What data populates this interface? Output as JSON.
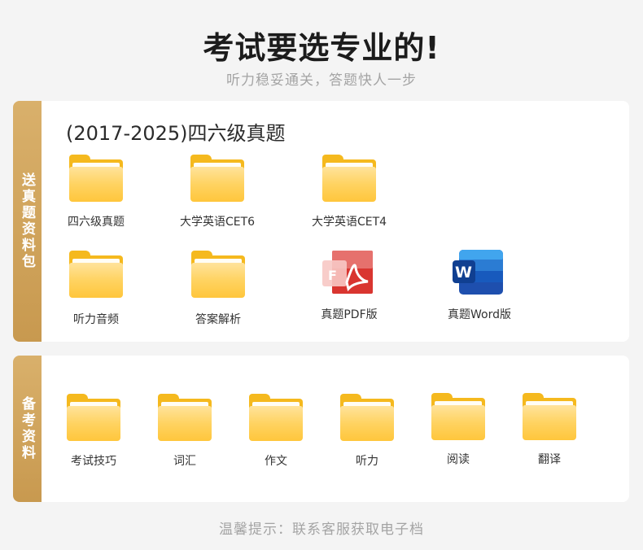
{
  "header": {
    "title": "考试要选专业的!",
    "subtitle": "听力稳妥通关，答题快人一步"
  },
  "section1": {
    "ribbon": "送真题资料包",
    "heading": "(2017-2025)四六级真题",
    "items": [
      {
        "label": "四六级真题",
        "icon": "folder-icon"
      },
      {
        "label": "大学英语CET6",
        "icon": "folder-icon"
      },
      {
        "label": "大学英语CET4",
        "icon": "folder-icon"
      },
      {
        "label": "听力音频",
        "icon": "folder-icon"
      },
      {
        "label": "答案解析",
        "icon": "folder-icon"
      },
      {
        "label": "真题PDF版",
        "icon": "pdf-icon"
      },
      {
        "label": "真题Word版",
        "icon": "word-icon"
      }
    ]
  },
  "section2": {
    "ribbon": "备考资料",
    "items": [
      {
        "label": "考试技巧",
        "icon": "folder-icon"
      },
      {
        "label": "词汇",
        "icon": "folder-icon"
      },
      {
        "label": "作文",
        "icon": "folder-icon"
      },
      {
        "label": "听力",
        "icon": "folder-icon"
      },
      {
        "label": "阅读",
        "icon": "folder-icon"
      },
      {
        "label": "翻译",
        "icon": "folder-icon"
      }
    ]
  },
  "footer": {
    "note": "温馨提示：联系客服获取电子档"
  },
  "colors": {
    "ribbon": "#c8994f",
    "folder": "#ffd361",
    "pdf": "#d93530",
    "word": "#2b6fd6"
  }
}
